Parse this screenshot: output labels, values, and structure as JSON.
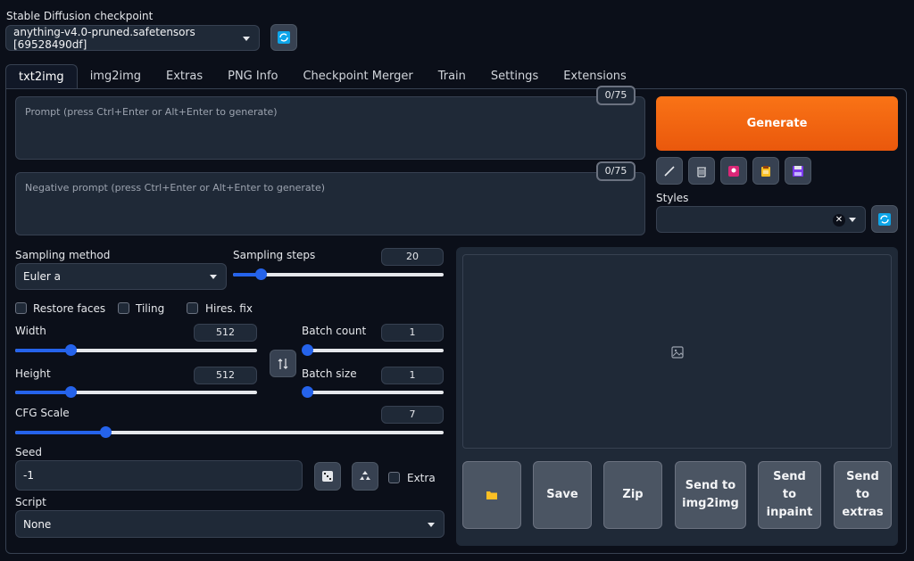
{
  "checkpoint": {
    "label": "Stable Diffusion checkpoint",
    "value": "anything-v4.0-pruned.safetensors [69528490df]"
  },
  "tabs": [
    "txt2img",
    "img2img",
    "Extras",
    "PNG Info",
    "Checkpoint Merger",
    "Train",
    "Settings",
    "Extensions"
  ],
  "prompt": {
    "placeholder": "Prompt (press Ctrl+Enter or Alt+Enter to generate)",
    "counter": "0/75"
  },
  "negative_prompt": {
    "placeholder": "Negative prompt (press Ctrl+Enter or Alt+Enter to generate)",
    "counter": "0/75"
  },
  "generate_label": "Generate",
  "styles_label": "Styles",
  "sampling": {
    "method_label": "Sampling method",
    "method_value": "Euler a",
    "steps_label": "Sampling steps",
    "steps_value": "20",
    "steps_fraction": 0.13
  },
  "checkboxes": {
    "restore_faces": "Restore faces",
    "tiling": "Tiling",
    "hires_fix": "Hires. fix",
    "extra": "Extra"
  },
  "width": {
    "label": "Width",
    "value": "512",
    "fraction": 0.23
  },
  "height": {
    "label": "Height",
    "value": "512",
    "fraction": 0.23
  },
  "batch_count": {
    "label": "Batch count",
    "value": "1",
    "fraction": 0.0
  },
  "batch_size": {
    "label": "Batch size",
    "value": "1",
    "fraction": 0.0
  },
  "cfg": {
    "label": "CFG Scale",
    "value": "7",
    "fraction": 0.21
  },
  "seed": {
    "label": "Seed",
    "value": "-1"
  },
  "script": {
    "label": "Script",
    "value": "None"
  },
  "actions": {
    "save": "Save",
    "zip": "Zip",
    "send_img2img": "Send to img2img",
    "send_inpaint": "Send to inpaint",
    "send_extras": "Send to extras"
  },
  "colors": {
    "accent": "#2563eb",
    "generate": "#f97316",
    "background": "#0b0f19"
  }
}
